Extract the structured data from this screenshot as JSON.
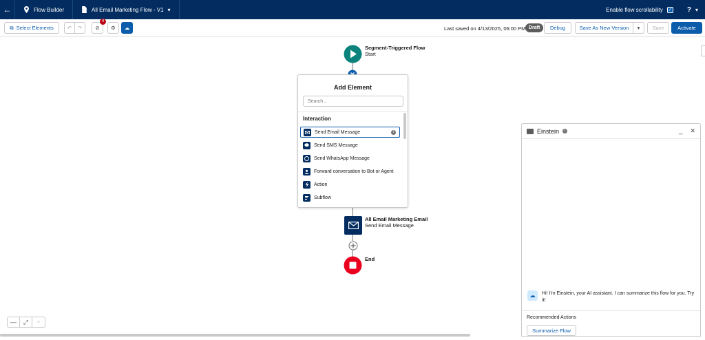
{
  "header": {
    "app_title": "Flow Builder",
    "flow_title": "All Email Marketing Flow - V1",
    "scroll_label": "Enable flow scrollability",
    "help_label": "?"
  },
  "toolbar": {
    "select_elements": "Select Elements",
    "error_count": "4",
    "last_saved": "Last saved on 4/13/2025, 06:00 PM",
    "status": "Draft",
    "debug": "Debug",
    "save_as_new": "Save As New Version",
    "save": "Save",
    "activate": "Activate"
  },
  "flow": {
    "start_title": "Segment-Triggered Flow",
    "start_sub": "Start",
    "email_title": "All Email Marketing Email",
    "email_sub": "Send Email Message",
    "end_title": "End"
  },
  "add_element": {
    "title": "Add Element",
    "search_placeholder": "Search...",
    "section": "Interaction",
    "items": [
      {
        "label": "Send Email Message",
        "icon": "email-icon"
      },
      {
        "label": "Send SMS Message",
        "icon": "sms-icon"
      },
      {
        "label": "Send WhatsApp Message",
        "icon": "whatsapp-icon"
      },
      {
        "label": "Forward conversation to Bot or Agent",
        "icon": "agent-icon"
      },
      {
        "label": "Action",
        "icon": "lightning-icon"
      },
      {
        "label": "Subflow",
        "icon": "subflow-icon"
      }
    ]
  },
  "einstein": {
    "title": "Einstein",
    "message": "Hi! I'm Einstein, your AI assistant. I can summarize this flow for you. Try it!",
    "recommended_label": "Recommended Actions",
    "summarize_button": "Summarize Flow"
  },
  "colors": {
    "brand_dark": "#032d60",
    "brand_blue": "#0b5cab",
    "start_green": "#0b827c",
    "end_red": "#ea001e"
  }
}
